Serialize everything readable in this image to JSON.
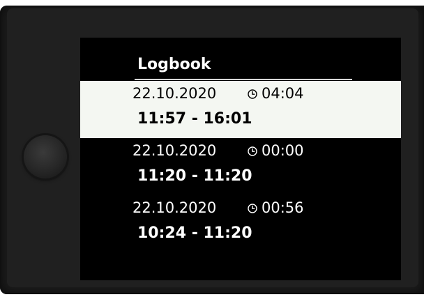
{
  "screen": {
    "title": "Logbook"
  },
  "entries": [
    {
      "date": "22.10.2020",
      "duration": "04:04",
      "time_range": "11:57 - 16:01",
      "selected": true
    },
    {
      "date": "22.10.2020",
      "duration": "00:00",
      "time_range": "11:20 - 11:20",
      "selected": false
    },
    {
      "date": "22.10.2020",
      "duration": "00:56",
      "time_range": "10:24 - 11:20",
      "selected": false
    }
  ],
  "icons": {
    "duration": "clock-icon",
    "button": "knob-button"
  },
  "colors": {
    "screen_background": "#000000",
    "selection_highlight": "#f4f7f2",
    "bezel": "#1c1c1c"
  }
}
